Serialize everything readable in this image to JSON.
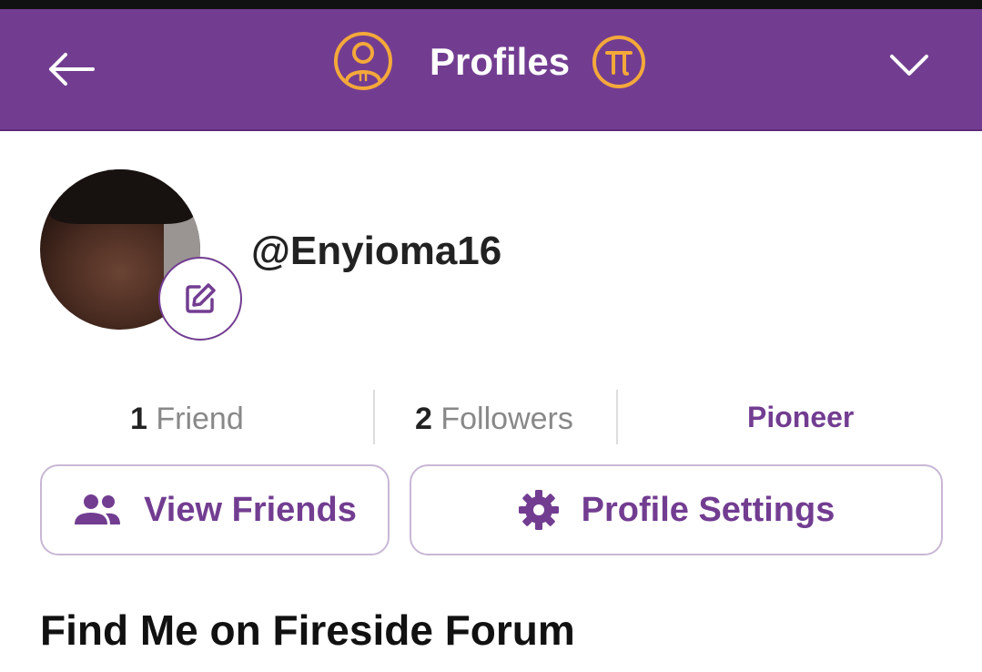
{
  "header": {
    "title": "Profiles",
    "back_icon": "arrow-left-icon",
    "profile_icon": "user-pi-circle-icon",
    "pi_icon": "pi-coin-icon",
    "menu_icon": "chevron-down-icon",
    "bg_color": "#723d91",
    "icon_color": "#f4a83a"
  },
  "profile": {
    "username": "@Enyioma16",
    "edit_icon": "pencil-square-icon"
  },
  "stats": {
    "friends_count": "1",
    "friends_label": "Friend",
    "followers_count": "2",
    "followers_label": "Followers",
    "role": "Pioneer"
  },
  "actions": {
    "view_friends_label": "View Friends",
    "view_friends_icon": "people-icon",
    "profile_settings_label": "Profile Settings",
    "profile_settings_icon": "gear-icon"
  },
  "section": {
    "title": "Find Me on Fireside Forum"
  },
  "colors": {
    "accent": "#723d91",
    "button_border": "#c9b7d6"
  }
}
